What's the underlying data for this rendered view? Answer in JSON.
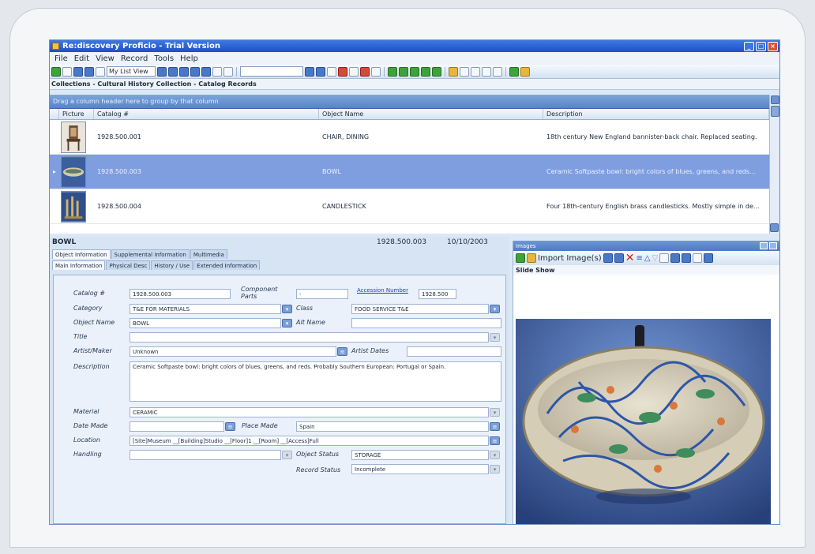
{
  "window": {
    "title": "Re:discovery Proficio - Trial Version"
  },
  "menu": [
    "File",
    "Edit",
    "View",
    "Record",
    "Tools",
    "Help"
  ],
  "toolbar": {
    "view_select": "My List View"
  },
  "breadcrumb": "Collections - Cultural History Collection - Catalog Records",
  "grid": {
    "group_hint": "Drag a column header here to group by that column",
    "columns": [
      "Picture",
      "Catalog #",
      "Object Name",
      "Description"
    ],
    "rows": [
      {
        "catalog": "1928.500.001",
        "object": "CHAIR, DINING",
        "description": "18th century New England bannister-back chair.  Replaced seating."
      },
      {
        "catalog": "1928.500.003",
        "object": "BOWL",
        "description": "Ceramic Softpaste bowl: bright colors of blues, greens, and reds..."
      },
      {
        "catalog": "1928.500.004",
        "object": "CANDLESTICK",
        "description": "Four 18th-century English brass candlesticks. Mostly simple in de..."
      }
    ]
  },
  "detail": {
    "header_name": "BOWL",
    "header_num": "1928.500.003",
    "header_date": "10/10/2003",
    "tabs": [
      "Object Information",
      "Supplemental Information",
      "Multimedia"
    ],
    "subtabs": [
      "Main Information",
      "Physical Desc",
      "History / Use",
      "Extended Information"
    ],
    "labels": {
      "catalog": "Catalog #",
      "component": "Component Parts",
      "accession": "Accession Number",
      "category": "Category",
      "class": "Class",
      "object_name": "Object Name",
      "alt_name": "Alt Name",
      "title": "Title",
      "artist": "Artist/Maker",
      "artist_dates": "Artist Dates",
      "description": "Description",
      "material": "Material",
      "date_made": "Date Made",
      "place_made": "Place Made",
      "location": "Location",
      "handling": "Handling",
      "object_status": "Object Status",
      "record_status": "Record Status"
    },
    "values": {
      "catalog": "1928.500.003",
      "component": "-",
      "accession": "1928.500",
      "category": "T&E FOR MATERIALS",
      "class": "FOOD SERVICE T&E",
      "object_name": "BOWL",
      "artist": "Unknown",
      "description": "Ceramic Softpaste bowl: bright colors of blues, greens, and reds.  Probably Southern European: Portugal or Spain.",
      "material": "CERAMIC",
      "place_made": "Spain",
      "location": "[Site]Museum __[Building]Studio __[Floor]1 __[Room] __[Access]Full",
      "object_status": "STORAGE",
      "record_status": "Incomplete"
    }
  },
  "images": {
    "title": "Images",
    "import_label": "Import Image(s)",
    "slideshow_label": "Slide Show"
  }
}
